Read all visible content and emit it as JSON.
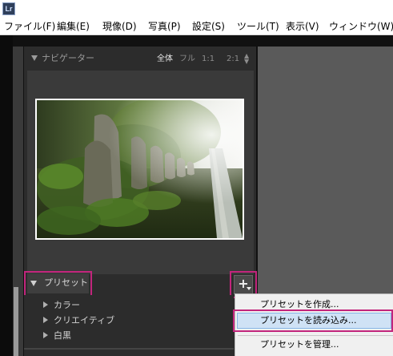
{
  "window": {
    "app_icon_text": "Lr"
  },
  "menubar": {
    "items": [
      "ファイル(F)",
      "編集(E)",
      "現像(D)",
      "写真(P)",
      "設定(S)",
      "ツール(T)",
      "表示(V)",
      "ウィンドウ(W)"
    ]
  },
  "navigator": {
    "title": "ナビゲーター",
    "zoom_options": [
      "全体",
      "フル",
      "1:1",
      "2:1"
    ],
    "active_zoom": "全体",
    "zoom_stepper_icon": "up-down-arrows-icon"
  },
  "presets": {
    "title": "プリセット",
    "add_button_label": "+",
    "items": [
      "カラー",
      "クリエイティブ",
      "白黒"
    ]
  },
  "context_menu": {
    "items": [
      "プリセットを作成...",
      "プリセットを読み込み...",
      "プリセットを管理..."
    ],
    "highlighted": "プリセットを読み込み..."
  },
  "colors": {
    "highlight_outline": "#c2257c",
    "menu_hover": "#cfe2f5",
    "panel_bg": "#2c2c2c"
  }
}
